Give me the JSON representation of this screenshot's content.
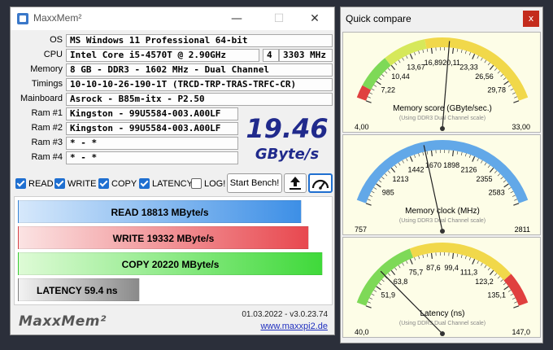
{
  "main": {
    "title": "MaxxMem²",
    "window_buttons": {
      "minimize": "—",
      "maximize": "☐",
      "close": "✕"
    },
    "rows": [
      {
        "label": "OS",
        "value": "MS Windows 11 Professional 64-bit"
      },
      {
        "label": "CPU",
        "value": "Intel Core i5-4570T @ 2.90GHz",
        "cores": "4",
        "clock": "3303 MHz"
      },
      {
        "label": "Memory",
        "value": "8 GB - DDR3 - 1602 MHz - Dual Channel"
      },
      {
        "label": "Timings",
        "value": "10-10-10-26-190-1T (TRCD-TRP-TRAS-TRFC-CR)"
      },
      {
        "label": "Mainboard",
        "value": "Asrock - B85m-itx - P2.50"
      },
      {
        "label": "Ram #1",
        "value": "Kingston - 99U5584-003.A00LF"
      },
      {
        "label": "Ram #2",
        "value": "Kingston - 99U5584-003.A00LF"
      },
      {
        "label": "Ram #3",
        "value": "* - *"
      },
      {
        "label": "Ram #4",
        "value": "* - *"
      }
    ],
    "score": {
      "value": "19.46",
      "unit": "GByte/s"
    },
    "options": {
      "read": {
        "label": "READ",
        "checked": true
      },
      "write": {
        "label": "WRITE",
        "checked": true
      },
      "copy": {
        "label": "COPY",
        "checked": true
      },
      "latency": {
        "label": "LATENCY",
        "checked": true
      },
      "log": {
        "label": "LOG!",
        "checked": false
      }
    },
    "start_label": "Start Bench!",
    "bars": {
      "read": {
        "text": "READ  18813  MByte/s",
        "value": 18813
      },
      "write": {
        "text": "WRITE  19332  MByte/s",
        "value": 19332
      },
      "copy": {
        "text": "COPY  20220  MByte/s",
        "value": 20220
      },
      "latency": {
        "text": "LATENCY  59.4  ns",
        "value": 59.4
      }
    },
    "footer": {
      "brand": "MaxxMem²",
      "date": "01.03.2022 - v3.0.23.74",
      "site": "www.maxxpi2.de"
    }
  },
  "quick_compare": {
    "title": "Quick compare",
    "close": "x",
    "gauges": [
      {
        "title": "Memory score (GByte/sec.)",
        "subtitle": "(Using DDR3 Dual Channel scale)",
        "min": "4,00",
        "max": "33,00",
        "ticks": [
          "7,22",
          "10,44",
          "13,67",
          "16,89",
          "20,11",
          "23,33",
          "26,56",
          "29,78"
        ],
        "needle_fraction": 0.533
      },
      {
        "title": "Memory clock (MHz)",
        "subtitle": "(Using DDR3 Dual Channel scale)",
        "min": "757",
        "max": "2811",
        "ticks": [
          "985",
          "1213",
          "1442",
          "1670",
          "1898",
          "2126",
          "2355",
          "2583"
        ],
        "needle_fraction": 0.413
      },
      {
        "title": "Latency (ns)",
        "subtitle": "(Using DDR3 Dual Channel scale)",
        "min": "40,0",
        "max": "147,0",
        "ticks": [
          "51,9",
          "63,8",
          "75,7",
          "87,6",
          "99,4",
          "111,3",
          "123,2",
          "135,1"
        ],
        "needle_fraction": 0.181
      }
    ]
  }
}
